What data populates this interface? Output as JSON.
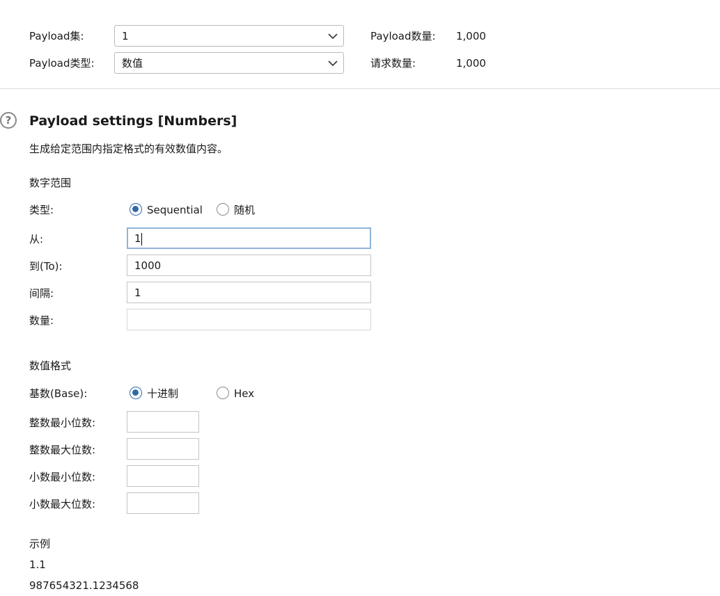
{
  "top": {
    "payload_set_label": "Payload集:",
    "payload_set_value": "1",
    "payload_type_label": "Payload类型:",
    "payload_type_value": "数值",
    "payload_count_label": "Payload数量:",
    "payload_count_value": "1,000",
    "request_count_label": "请求数量:",
    "request_count_value": "1,000"
  },
  "settings": {
    "title": "Payload settings [Numbers]",
    "description": "生成给定范围内指定格式的有效数值内容。",
    "range": {
      "heading": "数字范围",
      "type_label": "类型:",
      "type_options": [
        "Sequential",
        "随机"
      ],
      "type_selected": "Sequential",
      "from_label": "从:",
      "from_value": "1",
      "to_label": "到(To):",
      "to_value": "1000",
      "step_label": "间隔:",
      "step_value": "1",
      "count_label": "数量:",
      "count_value": ""
    },
    "format": {
      "heading": "数值格式",
      "base_label": "基数(Base):",
      "base_options": [
        "十进制",
        "Hex"
      ],
      "base_selected": "十进制",
      "min_int_label": "整数最小位数:",
      "max_int_label": "整数最大位数:",
      "min_frac_label": "小数最小位数:",
      "max_frac_label": "小数最大位数:"
    },
    "examples": {
      "heading": "示例",
      "items": [
        "1.1",
        "987654321.1234568"
      ]
    }
  }
}
